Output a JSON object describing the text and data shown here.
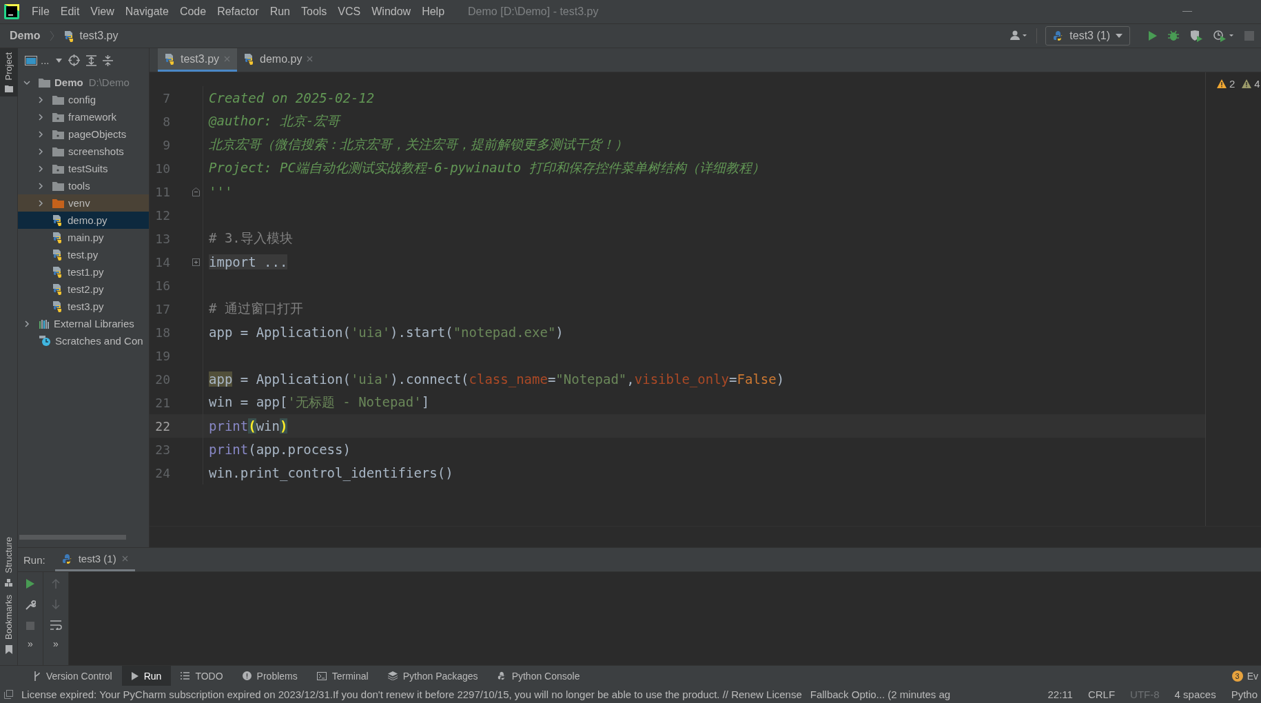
{
  "window": {
    "title": "Demo [D:\\Demo] - test3.py"
  },
  "menu": [
    "File",
    "Edit",
    "View",
    "Navigate",
    "Code",
    "Refactor",
    "Run",
    "Tools",
    "VCS",
    "Window",
    "Help"
  ],
  "breadcrumb": [
    "Demo",
    "test3.py"
  ],
  "run_config": {
    "label": "test3 (1)"
  },
  "side_stripe": {
    "top": "Project",
    "bottom": [
      "Structure",
      "Bookmarks"
    ]
  },
  "project_toolbar": {
    "title": "..."
  },
  "project_tree": [
    {
      "label": "Demo",
      "path": "D:\\Demo",
      "kind": "root",
      "expanded": true,
      "selected": false,
      "children": [
        {
          "label": "config",
          "kind": "folder",
          "expanded": false,
          "selected": false
        },
        {
          "label": "framework",
          "kind": "package",
          "expanded": false,
          "selected": false
        },
        {
          "label": "pageObjects",
          "kind": "package",
          "expanded": false,
          "selected": false
        },
        {
          "label": "screenshots",
          "kind": "folder",
          "expanded": false,
          "selected": false
        },
        {
          "label": "testSuits",
          "kind": "package",
          "expanded": false,
          "selected": false
        },
        {
          "label": "tools",
          "kind": "folder",
          "expanded": false,
          "selected": false
        },
        {
          "label": "venv",
          "kind": "excluded",
          "expanded": false,
          "selected": false
        },
        {
          "label": "demo.py",
          "kind": "python",
          "selected": true
        },
        {
          "label": "main.py",
          "kind": "python",
          "selected": false
        },
        {
          "label": "test.py",
          "kind": "python",
          "selected": false
        },
        {
          "label": "test1.py",
          "kind": "python",
          "selected": false
        },
        {
          "label": "test2.py",
          "kind": "python",
          "selected": false
        },
        {
          "label": "test3.py",
          "kind": "python",
          "selected": false
        }
      ]
    },
    {
      "label": "External Libraries",
      "kind": "libraries",
      "expanded": false,
      "selected": false
    },
    {
      "label": "Scratches and Con",
      "kind": "scratches",
      "selected": false
    }
  ],
  "editor_tabs": [
    {
      "label": "test3.py",
      "selected": true
    },
    {
      "label": "demo.py",
      "selected": false
    }
  ],
  "inspections": [
    {
      "count": "2",
      "kind": "warning"
    },
    {
      "count": "4",
      "kind": "weak"
    }
  ],
  "code_lines": [
    {
      "number": "7",
      "kind": "code",
      "current": false,
      "tokens": [
        {
          "text": "Created on 2025-02-12",
          "kind": "doc"
        }
      ]
    },
    {
      "number": "8",
      "kind": "code",
      "current": false,
      "tokens": [
        {
          "text": "@author: 北京-宏哥",
          "kind": "doc"
        }
      ]
    },
    {
      "number": "9",
      "kind": "code",
      "current": false,
      "tokens": [
        {
          "text": "北京宏哥（微信搜索：北京宏哥，关注宏哥，提前解锁更多测试干货！）",
          "kind": "doc"
        }
      ]
    },
    {
      "number": "10",
      "kind": "code",
      "current": false,
      "tokens": [
        {
          "text": "Project: PC端自动化测试实战教程-6-pywinauto 打印和保存控件菜单树结构（详细教程）",
          "kind": "doc"
        }
      ]
    },
    {
      "number": "11",
      "kind": "fold_end",
      "current": false,
      "tokens": [
        {
          "text": "'''",
          "kind": "doc"
        }
      ]
    },
    {
      "number": "12",
      "kind": "code",
      "current": false
    },
    {
      "number": "13",
      "kind": "code",
      "current": false,
      "tokens": [
        {
          "text": "# 3.导入模块",
          "kind": "comment"
        }
      ]
    },
    {
      "number": "14",
      "kind": "folded",
      "current": false,
      "tokens": [
        {
          "text": "import ...",
          "kind": "folded"
        }
      ]
    },
    {
      "number": "16",
      "kind": "code",
      "current": false
    },
    {
      "number": "17",
      "kind": "code",
      "current": false,
      "tokens": [
        {
          "text": "# 通过窗口打开",
          "kind": "comment"
        }
      ]
    },
    {
      "number": "18",
      "kind": "code",
      "current": false,
      "tokens": [
        {
          "text": "app = Application(",
          "kind": "plain"
        },
        {
          "text": "'uia'",
          "kind": "string"
        },
        {
          "text": ").start(",
          "kind": "plain"
        },
        {
          "text": "\"notepad.exe\"",
          "kind": "string"
        },
        {
          "text": ")",
          "kind": "plain"
        }
      ]
    },
    {
      "number": "19",
      "kind": "code",
      "current": false
    },
    {
      "number": "20",
      "kind": "code",
      "current": false,
      "tokens": [
        {
          "text": "app",
          "kind": "usage"
        },
        {
          "text": " = Application(",
          "kind": "plain"
        },
        {
          "text": "'uia'",
          "kind": "string"
        },
        {
          "text": ").connect(",
          "kind": "plain"
        },
        {
          "text": "class_name",
          "kind": "param"
        },
        {
          "text": "=",
          "kind": "plain"
        },
        {
          "text": "\"Notepad\"",
          "kind": "string"
        },
        {
          "text": ",",
          "kind": "plain"
        },
        {
          "text": "visible_only",
          "kind": "param"
        },
        {
          "text": "=",
          "kind": "plain"
        },
        {
          "text": "False",
          "kind": "keyword"
        },
        {
          "text": ")",
          "kind": "plain"
        }
      ]
    },
    {
      "number": "21",
      "kind": "code",
      "current": false,
      "tokens": [
        {
          "text": "win = app[",
          "kind": "plain"
        },
        {
          "text": "'无标题 - Notepad'",
          "kind": "string"
        },
        {
          "text": "]",
          "kind": "plain"
        }
      ]
    },
    {
      "number": "22",
      "kind": "code",
      "current": true,
      "tokens": [
        {
          "text": "print",
          "kind": "builtin"
        },
        {
          "text": "(",
          "kind": "brace"
        },
        {
          "text": "win",
          "kind": "plain"
        },
        {
          "text": ")",
          "kind": "brace"
        }
      ]
    },
    {
      "number": "23",
      "kind": "code",
      "current": false,
      "tokens": [
        {
          "text": "print",
          "kind": "builtin"
        },
        {
          "text": "(app.process)",
          "kind": "plain"
        }
      ]
    },
    {
      "number": "24",
      "kind": "code",
      "current": false,
      "tokens": [
        {
          "text": "win.print_control_identifiers()",
          "kind": "plain"
        }
      ]
    }
  ],
  "run_panel": {
    "label": "Run:",
    "tab": "test3 (1)",
    "side_more": [
      "»",
      "»"
    ]
  },
  "tool_tabs": [
    {
      "label": "Version Control",
      "kind": "vcs",
      "selected": false
    },
    {
      "label": "Run",
      "kind": "run",
      "selected": true
    },
    {
      "label": "TODO",
      "kind": "todo",
      "selected": false
    },
    {
      "label": "Problems",
      "kind": "problems",
      "selected": false
    },
    {
      "label": "Terminal",
      "kind": "terminal",
      "selected": false
    },
    {
      "label": "Python Packages",
      "kind": "packages",
      "selected": false
    },
    {
      "label": "Python Console",
      "kind": "console",
      "selected": false
    }
  ],
  "event_log": {
    "count": "3",
    "label": "Ev"
  },
  "status_bar": {
    "message": "License expired: Your PyCharm subscription expired on 2023/12/31.If you don't renew it before 2297/10/15, you will no longer be able to use the product. // Renew License",
    "fallback": "Fallback Optio... (2 minutes ag",
    "items": [
      {
        "text": "22:11",
        "disabled": false
      },
      {
        "text": "CRLF",
        "disabled": false
      },
      {
        "text": "UTF-8",
        "disabled": true
      },
      {
        "text": "4 spaces",
        "disabled": false
      },
      {
        "text": "Pytho",
        "disabled": false
      }
    ]
  }
}
